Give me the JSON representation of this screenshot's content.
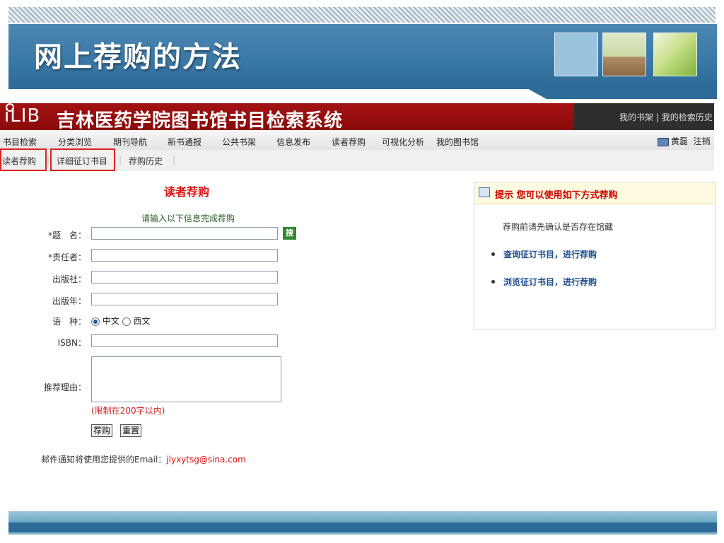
{
  "slide": {
    "title": "网上荐购的方法"
  },
  "site": {
    "logo": "iLIB",
    "title": "吉林医药学院图书馆书目检索系统",
    "top_links": [
      "我的书架",
      "我的检索历史"
    ],
    "user": {
      "name": "黄磊",
      "logout": "注销"
    }
  },
  "nav": [
    "书目检索",
    "分类浏览",
    "期刊导航",
    "新书通报",
    "公共书架",
    "信息发布",
    "读者荐购",
    "可视化分析",
    "我的图书馆"
  ],
  "subnav": [
    "读者荐购",
    "详细征订书目",
    "荐购历史"
  ],
  "form": {
    "title": "读者荐购",
    "hint": "请输入以下信息完成荐购",
    "fields": {
      "title": "*题　名：",
      "author": "*责任者：",
      "publisher": "出版社：",
      "year": "出版年：",
      "language": "语　种：",
      "isbn": "ISBN：",
      "reason": "推荐理由："
    },
    "search_button": "搜",
    "language_options": [
      "中文",
      "西文"
    ],
    "language_selected": "中文",
    "limit_note": "(限制在200字以内)",
    "submit": "荐购",
    "reset": "重置",
    "email_text": "邮件通知将使用您提供的Email：",
    "email": "jlyxytsg@sina.com"
  },
  "tip": {
    "title": "提示  您可以使用如下方式荐购",
    "desc": "荐购前请先确认是否存在馆藏",
    "links": [
      "查询征订书目，进行荐购",
      "浏览征订书目，进行荐购"
    ]
  }
}
